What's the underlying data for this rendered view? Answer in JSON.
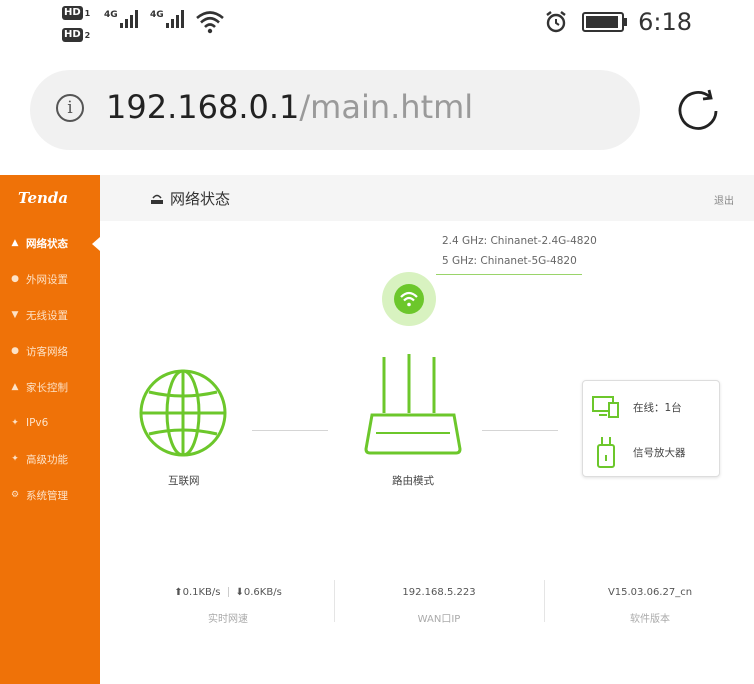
{
  "status_bar": {
    "sim1": {
      "badge": "HD",
      "num": "1",
      "net": "4G"
    },
    "sim2": {
      "badge": "HD",
      "num": "2",
      "net": "4G"
    },
    "time": "6:18"
  },
  "browser": {
    "url_host": "192.168.0.1",
    "url_path": "/main.html"
  },
  "sidebar": {
    "logo": "Tenda",
    "items": [
      {
        "label": "网络状态",
        "icon": "network-status-icon",
        "active": true
      },
      {
        "label": "外网设置",
        "icon": "globe-icon"
      },
      {
        "label": "无线设置",
        "icon": "wifi-icon"
      },
      {
        "label": "访客网络",
        "icon": "guest-icon"
      },
      {
        "label": "家长控制",
        "icon": "parental-icon"
      },
      {
        "label": "IPv6",
        "icon": "ipv6-icon"
      },
      {
        "label": "高级功能",
        "icon": "tools-icon"
      },
      {
        "label": "系统管理",
        "icon": "gear-icon"
      }
    ]
  },
  "header": {
    "title": "网络状态",
    "logout": "退出"
  },
  "wifi": {
    "ssid_24": "2.4 GHz: Chinanet-2.4G-4820",
    "ssid_5": "5 GHz: Chinanet-5G-4820"
  },
  "diagram": {
    "internet_label": "互联网",
    "router_label": "路由模式",
    "online_text": "在线：1台",
    "extender_text": "信号放大器"
  },
  "footer": {
    "upload": "0.1KB/s",
    "download": "0.6KB/s",
    "speed_label": "实时网速",
    "wan_ip": "192.168.5.223",
    "wan_label": "WAN口IP",
    "firmware": "V15.03.06.27_cn",
    "firmware_label": "软件版本"
  },
  "colors": {
    "brand_orange": "#ef7208",
    "accent_green": "#6cc72b"
  }
}
